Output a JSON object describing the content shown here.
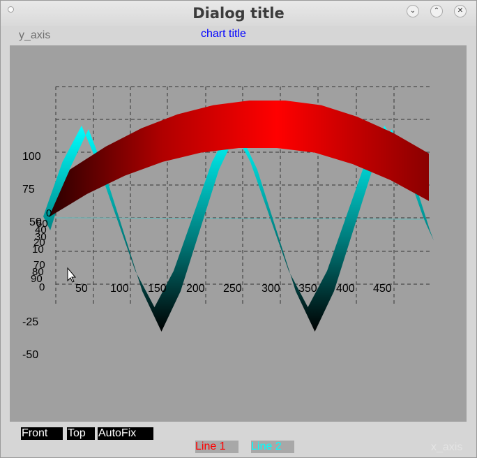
{
  "window": {
    "title": "Dialog title"
  },
  "toolbar": {
    "front_label": "Front",
    "top_label": "Top",
    "autofix_label": "AutoFix"
  },
  "colors": {
    "line1": "#ff0000",
    "line2": "#00ffff",
    "background": "#a0a0a0"
  },
  "chart_data": {
    "type": "area",
    "title": "chart title",
    "xlabel": "x_axis",
    "ylabel": "y_axis",
    "view": "3d",
    "grid": true,
    "legend_placement": "bottom",
    "x_ticks": [
      "50",
      "100",
      "150",
      "200",
      "250",
      "300",
      "350",
      "400",
      "450"
    ],
    "y_ticks": [
      "100",
      "75",
      "50",
      "-25",
      "-50"
    ],
    "z_ticks": [
      "0",
      "50",
      "40",
      "30",
      "20",
      "10",
      "70",
      "80",
      "90",
      "0"
    ],
    "xlim": [
      0,
      500
    ],
    "ylim": [
      -60,
      125
    ],
    "series": [
      {
        "name": "Line 1",
        "color": "#ff0000",
        "x": [
          0,
          50,
          100,
          150,
          200,
          250,
          300,
          350,
          400,
          450,
          500
        ],
        "y": [
          70,
          80,
          88,
          94,
          98,
          100,
          100,
          98,
          93,
          86,
          77
        ]
      },
      {
        "name": "Line 2",
        "color": "#00ffff",
        "x": [
          0,
          25,
          50,
          70,
          95,
          120,
          145,
          170,
          195,
          220,
          245,
          270,
          295,
          320,
          345,
          370,
          395,
          420,
          445,
          470,
          495,
          500
        ],
        "y": [
          0,
          60,
          100,
          60,
          0,
          -60,
          -100,
          -60,
          0,
          60,
          100,
          60,
          0,
          -60,
          -100,
          -60,
          0,
          60,
          100,
          60,
          0,
          -10
        ]
      }
    ]
  }
}
